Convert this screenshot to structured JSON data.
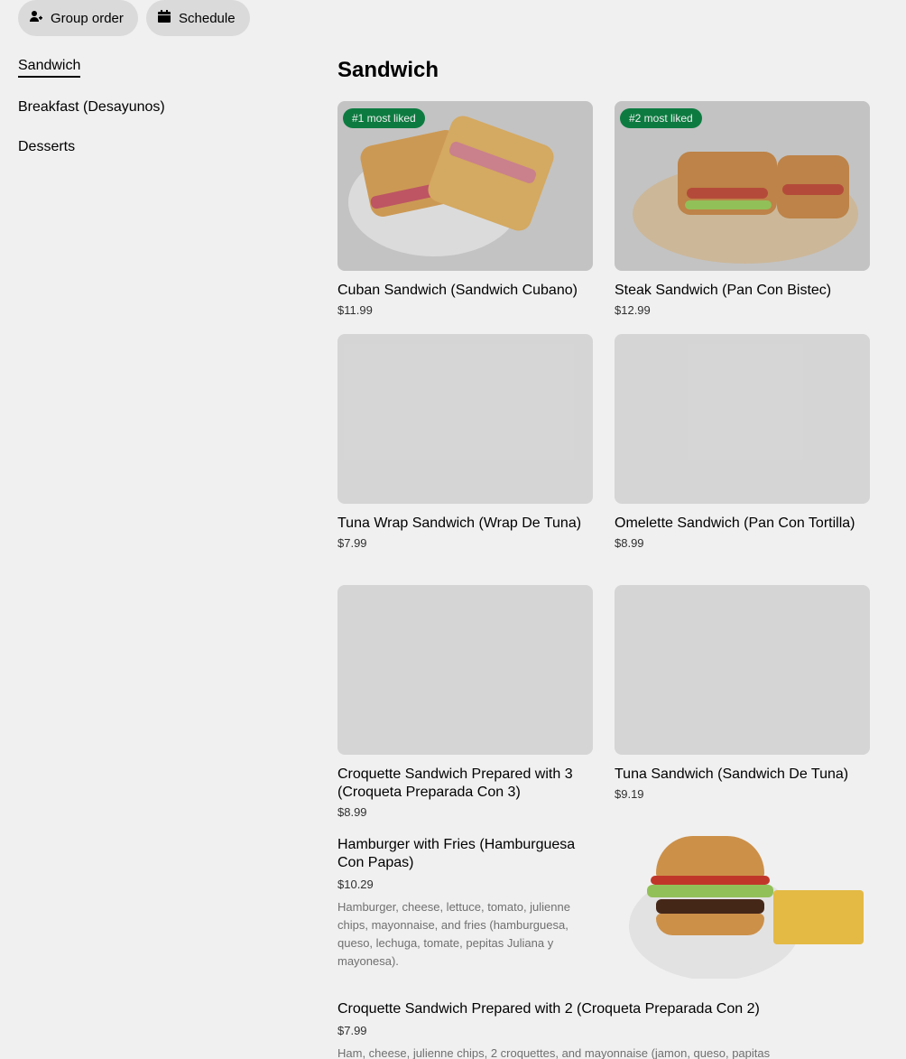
{
  "top_bar": {
    "group_order_label": "Group order",
    "schedule_label": "Schedule"
  },
  "sidebar": {
    "items": [
      {
        "label": "Sandwich"
      },
      {
        "label": "Breakfast (Desayunos)"
      },
      {
        "label": "Desserts"
      }
    ]
  },
  "main": {
    "section_title": "Sandwich",
    "cards": [
      {
        "name": "Cuban Sandwich (Sandwich Cubano)",
        "price": "$11.99",
        "badge": "#1 most liked"
      },
      {
        "name": "Steak Sandwich (Pan Con Bistec)",
        "price": "$12.99",
        "badge": "#2 most liked"
      },
      {
        "name": "Tuna Wrap Sandwich (Wrap De Tuna)",
        "price": "$7.99"
      },
      {
        "name": "Omelette Sandwich (Pan Con Tortilla)",
        "price": "$8.99"
      },
      {
        "name": "Croquette Sandwich Prepared with 3 (Croqueta Preparada Con 3)",
        "price": "$8.99"
      },
      {
        "name": "Tuna Sandwich (Sandwich De Tuna)",
        "price": "$9.19"
      }
    ],
    "list_items": [
      {
        "name": "Hamburger with Fries (Hamburguesa Con Papas)",
        "price": "$10.29",
        "description": "Hamburger, cheese, lettuce, tomato, julienne chips, mayonnaise, and fries (hamburguesa, queso, lechuga, tomate, pepitas Juliana y mayonesa)."
      },
      {
        "name": "Croquette Sandwich Prepared with 2 (Croqueta Preparada Con 2)",
        "price": "$7.99",
        "description": "Ham, cheese, julienne chips, 2 croquettes, and mayonnaise (jamon, queso, papitas"
      }
    ]
  },
  "colors": {
    "badge_green": "#0e8345",
    "pill_bg": "#e8e8e8",
    "placeholder": "#e3e3e3"
  }
}
